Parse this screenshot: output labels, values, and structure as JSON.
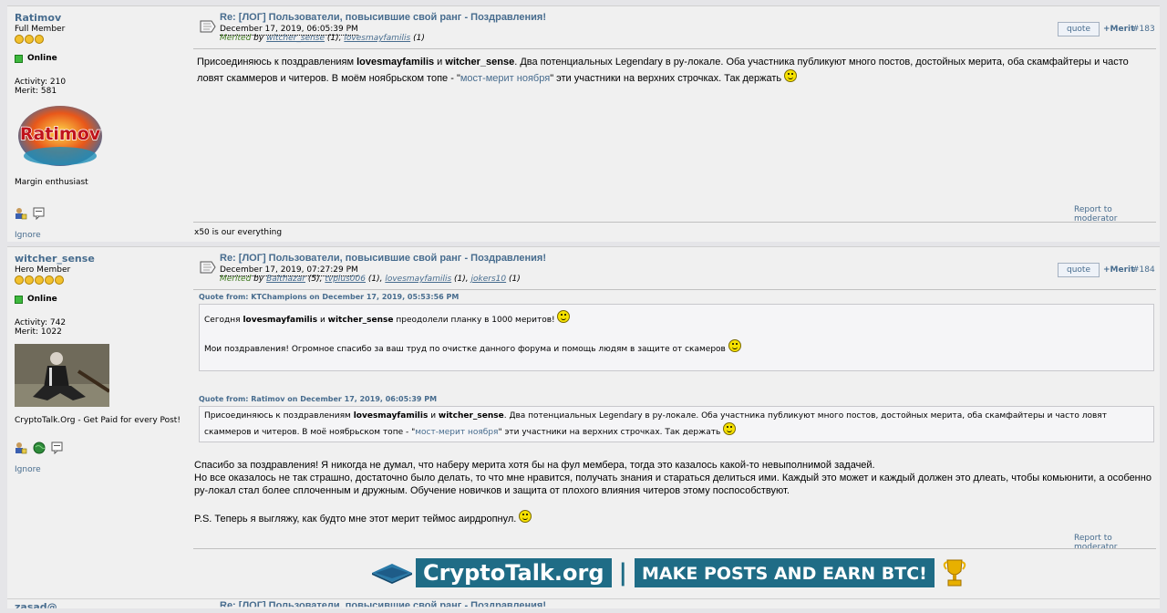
{
  "posts": [
    {
      "username": "Ratimov",
      "rank": "Full Member",
      "star_count": 3,
      "status": "Online",
      "activity": "Activity: 210",
      "merit": "Merit: 581",
      "avatar_text": "Ratimov",
      "personal_text": "Margin enthusiast",
      "ignore": "Ignore",
      "subject": "Re: [ЛОГ] Пользователи, повысившие свой ранг - Поздравления!",
      "date": "December 17, 2019, 06:05:39 PM",
      "merited_word": "Merited",
      "merited_by": "by",
      "merits": [
        {
          "name": "witcher_sense",
          "count": "(1)"
        },
        {
          "name": "lovesmayfamilis",
          "count": "(1)"
        }
      ],
      "quote_label": "quote",
      "merit_label": "+Merit",
      "post_number": "#183",
      "body": {
        "p1": "Присоединяюсь к поздравлениям ",
        "bold1": "lovesmayfamilis",
        "p2": " и ",
        "bold2": "witcher_sense",
        "p3": ". Два потенциальных Legendary  в ру-локале. Оба участника публикуют много постов, достойных мерита, оба скамфайтеры и часто ловят скаммеров и читеров. В моём ноябрьском топе - \"",
        "link": "мост-мерит ноября",
        "p4": "\" эти участники на верхних строчках. Так держать "
      },
      "report": "Report to moderator",
      "signature": "x50 is our everything"
    },
    {
      "username": "witcher_sense",
      "rank": "Hero Member",
      "star_count": 5,
      "status": "Online",
      "activity": "Activity: 742",
      "merit": "Merit: 1022",
      "personal_text": "CryptoTalk.Org - Get Paid for every Post!",
      "ignore": "Ignore",
      "subject": "Re: [ЛОГ] Пользователи, повысившие свой ранг - Поздравления!",
      "date": "December 17, 2019, 07:27:29 PM",
      "merited_word": "Merited",
      "merited_by": "by",
      "merits": [
        {
          "name": "Balthazar",
          "count": "(5)"
        },
        {
          "name": "tvplus006",
          "count": "(1)"
        },
        {
          "name": "lovesmayfamilis",
          "count": "(1)"
        },
        {
          "name": "jokers10",
          "count": "(1)"
        }
      ],
      "quote_label": "quote",
      "merit_label": "+Merit",
      "post_number": "#184",
      "quote1": {
        "header": "Quote from: KTChampions on December 17, 2019, 05:53:56 PM",
        "l1a": "Сегодня ",
        "l1b": "lovesmayfamilis",
        "l1c": " и ",
        "l1d": "witcher_sense",
        "l1e": " преодолели планку в 1000 меритов! ",
        "l2": "Мои поздравления! Огромное спасибо за ваш труд по очистке данного форума и помощь людям в защите от скамеров "
      },
      "quote2": {
        "header": "Quote from: Ratimov on December 17, 2019, 06:05:39 PM",
        "a": "Присоединяюсь к поздравлениям ",
        "b": "lovesmayfamilis",
        "c": " и ",
        "d": "witcher_sense",
        "e": ". Два потенциальных Legendary  в ру-локале. Оба участника публикуют много постов, достойных мерита, оба скамфайтеры и часто ловят скаммеров и читеров. В моё ноябрьском топе - \"",
        "link": "мост-мерит ноября",
        "f": "\" эти участники на верхних строчках. Так держать "
      },
      "reply": {
        "l1": "Спасибо за поздравления! Я никогда не думал, что наберу мерита хотя бы на фул мембера, тогда это казалось какой-то невыполнимой задачей.",
        "l2": "Но все оказалось не так страшно, достаточно было делать, то что мне нравится, получать знания и стараться делиться ими. Каждый это может и каждый должен это длеать, чтобы комьюнити, а особенно ру-локал стал более сплоченным и дружным. Обучение новичков и защита от плохого влияния читеров этому поспособствуют.",
        "l3": "P.S. Теперь я выгляжу, как будто мне этот мерит теймос аирдропнул. "
      },
      "report": "Report to moderator",
      "banner": {
        "brand": "CryptoTalk.org",
        "sep": "|",
        "slogan": "MAKE POSTS AND EARN BTC!"
      }
    },
    {
      "username": "zasad@",
      "subject": "Re: [ЛОГ] Пользователи, повысившие свой ранг - Поздравления!"
    }
  ],
  "colors": {
    "link": "#476c8e",
    "merited": "#407a20",
    "online": "#3eb83e",
    "banner": "#1f6c86"
  }
}
